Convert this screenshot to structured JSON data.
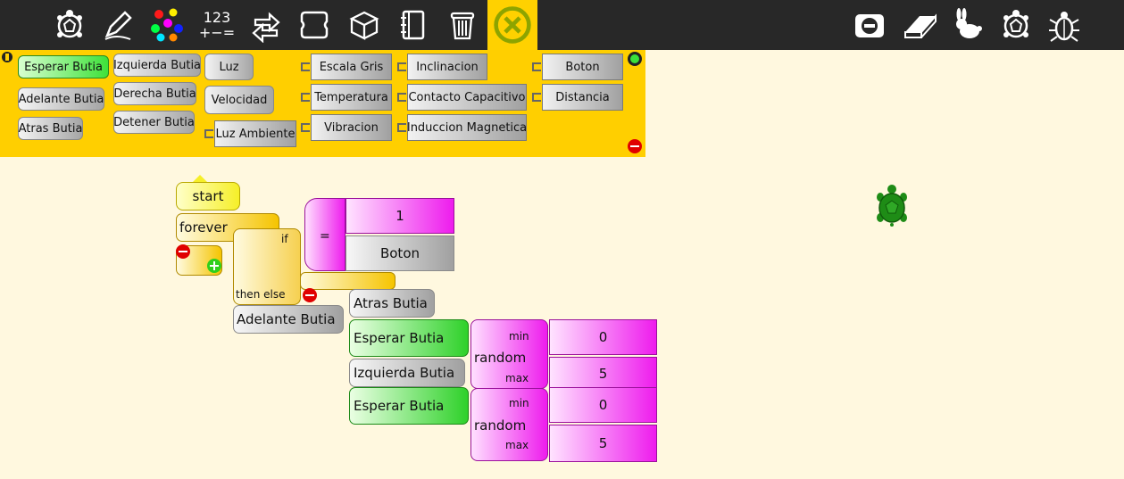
{
  "toolbar": {
    "icons": [
      "turtle-icon",
      "pen-icon",
      "palette-icon",
      "numbers-icon",
      "flow-icon",
      "blocks-icon",
      "box-icon",
      "notebook-icon",
      "trash-icon",
      "close-palette-icon"
    ],
    "numbers_line1": "123",
    "numbers_line2": "+−=",
    "right_icons": [
      "stop-icon",
      "eraser-icon",
      "rabbit-icon",
      "turtle-slow-icon",
      "bug-icon"
    ],
    "accent": "#ffd100"
  },
  "palette": {
    "col1": [
      "Esperar Butia",
      "Adelante Butia",
      "Atras Butia"
    ],
    "col2": [
      "Izquierda Butia",
      "Derecha Butia",
      "Detener Butia"
    ],
    "col3": [
      "Luz",
      "Velocidad",
      "Luz Ambiente"
    ],
    "col4": [
      "Escala Gris",
      "Temperatura",
      "Vibracion"
    ],
    "col5": [
      "Inclinacion",
      "Contacto Capacitivo",
      "Induccion Magnetica"
    ],
    "col6": [
      "Boton",
      "Distancia"
    ]
  },
  "program": {
    "start": "start",
    "forever": "forever",
    "if": "if",
    "then_else": "then else",
    "eq": "=",
    "eq_left": "1",
    "eq_right": "Boton",
    "then_block": "Adelante Butia",
    "else_block_1": "Atras Butia",
    "else_block_2": "Esperar Butia",
    "else_block_3": "Izquierda Butia",
    "else_block_4": "Esperar Butia",
    "random_label": "random",
    "min_label": "min",
    "max_label": "max",
    "rand1_min": "0",
    "rand1_max": "5",
    "rand2_min": "0",
    "rand2_max": "5"
  },
  "canvas": {
    "background": "#fff8df",
    "turtle_color": "#1e8c16"
  }
}
